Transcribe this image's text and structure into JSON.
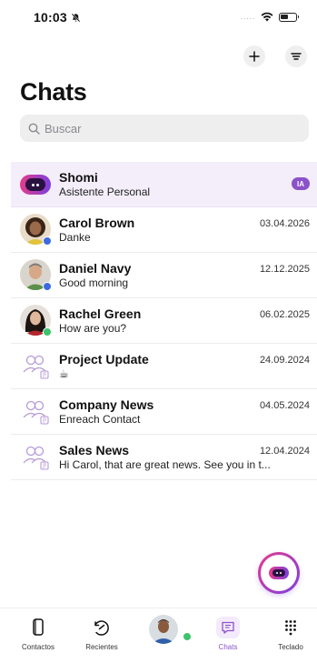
{
  "status_bar": {
    "time": "10:03",
    "signal": "....."
  },
  "header": {
    "title": "Chats"
  },
  "search": {
    "placeholder": "Buscar"
  },
  "chats": [
    {
      "name": "Shomi",
      "preview": "Asistente Personal",
      "badge": "IA",
      "type": "assistant"
    },
    {
      "name": "Carol Brown",
      "preview": "Danke",
      "date": "03.04.2026",
      "type": "person",
      "presence": "#3d6ae0"
    },
    {
      "name": "Daniel Navy",
      "preview": "Good morning",
      "date": "12.12.2025",
      "type": "person",
      "presence": "#3d6ae0"
    },
    {
      "name": "Rachel Green",
      "preview": "How are you?",
      "date": "06.02.2025",
      "type": "person",
      "presence": "#3cc36b"
    },
    {
      "name": "Project Update",
      "preview": "☕",
      "date": "24.09.2024",
      "type": "group"
    },
    {
      "name": "Company News",
      "preview": "Enreach Contact",
      "date": "04.05.2024",
      "type": "group"
    },
    {
      "name": "Sales News",
      "preview": "Hi Carol, that are great news. See you in t...",
      "date": "12.04.2024",
      "type": "group"
    }
  ],
  "tabs": [
    {
      "label": "Contactos",
      "icon": "contacts-icon"
    },
    {
      "label": "Recientes",
      "icon": "recents-icon"
    },
    {
      "label": "",
      "icon": "profile-avatar"
    },
    {
      "label": "Chats",
      "icon": "chat-icon",
      "active": true
    },
    {
      "label": "Teclado",
      "icon": "keypad-icon"
    }
  ],
  "colors": {
    "accent": "#8b52c9",
    "gradient_start": "#e63b8a",
    "gradient_end": "#7b3fe0",
    "featured_bg": "#f3eefa"
  }
}
